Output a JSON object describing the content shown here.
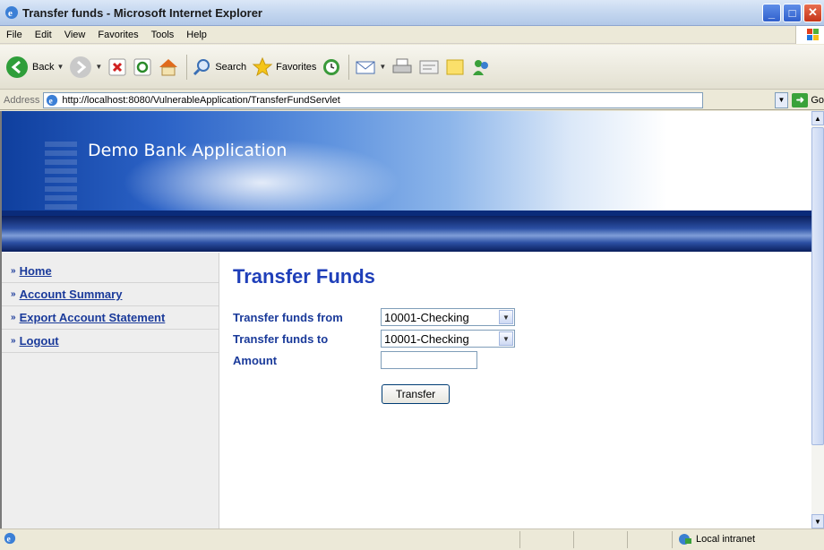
{
  "window": {
    "title": "Transfer funds - Microsoft Internet Explorer"
  },
  "menu": [
    "File",
    "Edit",
    "View",
    "Favorites",
    "Tools",
    "Help"
  ],
  "toolbar": {
    "back_label": "Back",
    "search_label": "Search",
    "favorites_label": "Favorites"
  },
  "address": {
    "label": "Address",
    "url": "http://localhost:8080/VulnerableApplication/TransferFundServlet",
    "go_label": "Go"
  },
  "banner": {
    "app_name": "Demo Bank Application"
  },
  "sidebar": {
    "items": [
      {
        "label": "Home"
      },
      {
        "label": "Account Summary"
      },
      {
        "label": "Export Account Statement"
      },
      {
        "label": "Logout"
      }
    ]
  },
  "form": {
    "heading": "Transfer Funds",
    "from_label": "Transfer funds from",
    "from_value": "10001-Checking",
    "to_label": "Transfer funds to",
    "to_value": "10001-Checking",
    "amount_label": "Amount",
    "amount_value": "",
    "submit_label": "Transfer"
  },
  "status": {
    "zone": "Local intranet"
  },
  "colors": {
    "link": "#1a3a9a",
    "heading": "#1f3fb9",
    "banner_dark": "#0a2b7a"
  }
}
